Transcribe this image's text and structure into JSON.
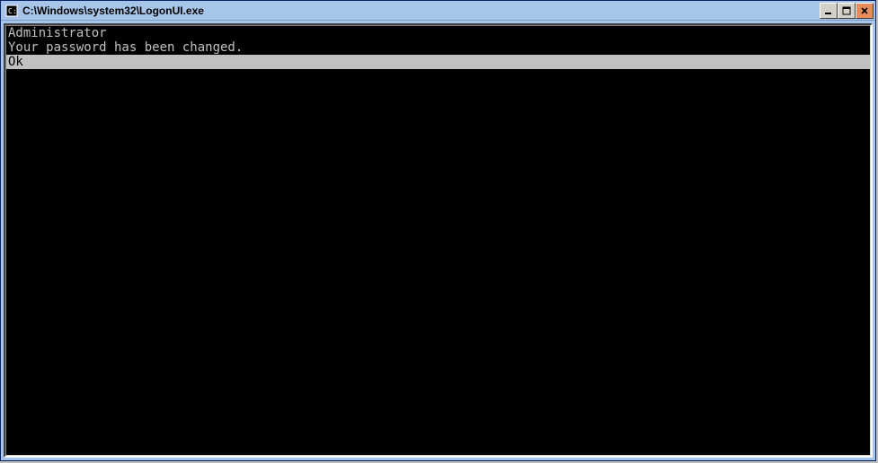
{
  "window": {
    "title": "C:\\Windows\\system32\\LogonUI.exe"
  },
  "console": {
    "line1": "Administrator",
    "line2": "Your password has been changed.",
    "line3": "Ok"
  }
}
